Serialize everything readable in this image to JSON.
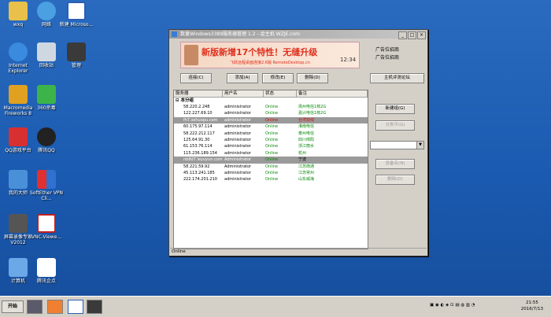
{
  "desktop": {
    "icons": [
      {
        "label": "wxq"
      },
      {
        "label": "网络"
      },
      {
        "label": "新建 Microso..."
      },
      {
        "label": "Internet Explorer"
      },
      {
        "label": "回收站"
      },
      {
        "label": "管理"
      },
      {
        "label": "Macromedia Fireworks 8"
      },
      {
        "label": "360杀毒"
      },
      {
        "label": "QQ游戏平台"
      },
      {
        "label": "腾讯QQ"
      },
      {
        "label": "我的大师"
      },
      {
        "label": "SoftEther VPN Cli..."
      },
      {
        "label": "屏幕录像专家V2012"
      },
      {
        "label": "VNC-Viewe..."
      },
      {
        "label": "计算机"
      },
      {
        "label": "腾讯企点"
      }
    ]
  },
  "window": {
    "title": "数量Windows3389服务器管理 1.2 --金主机 WZJE.com",
    "banner": {
      "main": "新版新增17个特性！无缝升级",
      "sub": "飞跃远程桌面连接2.6版 RemoteDesktop.cn",
      "clock": "12:34"
    },
    "ads": [
      "广告位招商",
      "广告位招商"
    ],
    "toolbar": {
      "connect": "连接(C)",
      "add": "添加(A)",
      "edit": "修改(E)",
      "delete": "删除(D)",
      "host_eval": "主机评测论坛"
    },
    "side": {
      "new_group": "新建组(G)",
      "rename_group": "分类平(G)",
      "import": "设备名(N)",
      "delete_group": "删除(D)"
    },
    "columns": [
      "服务器",
      "用户名",
      "状态",
      "备注"
    ],
    "group_name": "本分组",
    "rows": [
      {
        "server": "58.220.2.248",
        "user": "administrator",
        "status": "Online",
        "note": "扬州电信1核2G"
      },
      {
        "server": "122.227.69.10",
        "user": "administrator",
        "status": "Online",
        "note": "嘉兴电信1核2G"
      },
      {
        "server": "fh7.sehuopu.com",
        "user": "administrator",
        "status": "Online",
        "note": "台湾双线"
      },
      {
        "server": "60.175.97.114",
        "user": "administrator",
        "status": "Online",
        "note": "淮南电信"
      },
      {
        "server": "58.222.212.117",
        "user": "administrator",
        "status": "Online",
        "note": "泰州电信"
      },
      {
        "server": "125.64.91.30",
        "user": "administrator",
        "status": "Online",
        "note": "四川绵阳"
      },
      {
        "server": "61.153.76.114",
        "user": "administrator",
        "status": "Online",
        "note": "浙江丽水"
      },
      {
        "server": "115.236.189.154",
        "user": "administrator",
        "status": "Online",
        "note": "杭州"
      },
      {
        "server": "nb8d7.leyuyun.com",
        "user": "Administrator",
        "status": "Online",
        "note": "宁波"
      },
      {
        "server": "58.221.59.92",
        "user": "Administrator",
        "status": "Online",
        "note": "江苏南通"
      },
      {
        "server": "45.113.241.185",
        "user": "administrator",
        "status": "Online",
        "note": "江苏常州"
      },
      {
        "server": "222.174.201.210",
        "user": "administrator",
        "status": "Online",
        "note": "山东威海"
      }
    ],
    "status": "Online"
  },
  "taskbar": {
    "start": "开始",
    "time": "21:55",
    "date": "2016/7/13"
  },
  "colors": {
    "accent": "#1a5ab0",
    "online": "#0a8a0a",
    "highlight": "#d01010"
  }
}
